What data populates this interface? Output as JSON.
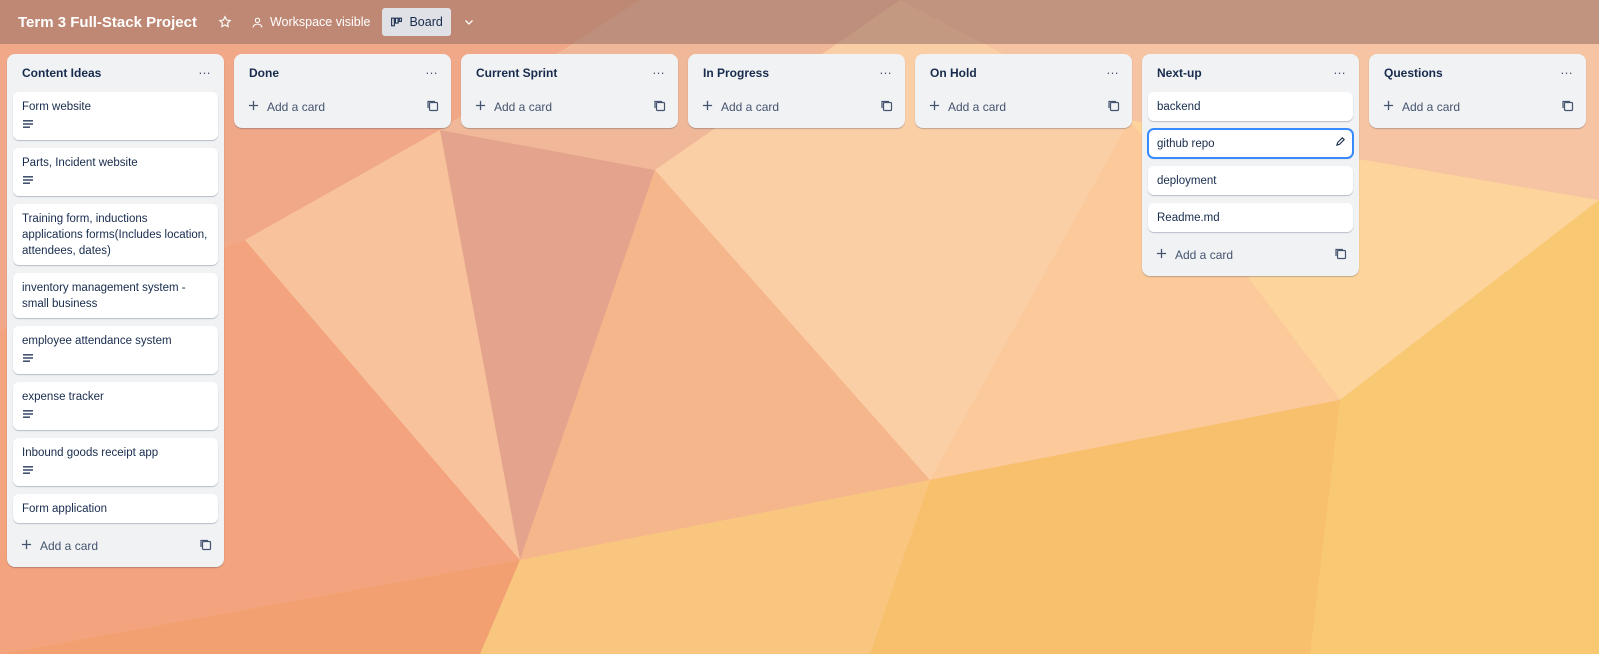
{
  "board": {
    "title": "Term 3 Full-Stack Project",
    "visibility_label": "Workspace visible",
    "view_label": "Board"
  },
  "add_card_label": "Add a card",
  "lists": [
    {
      "title": "Content Ideas",
      "cards": [
        {
          "title": "Form website",
          "has_description": true
        },
        {
          "title": "Parts, Incident website",
          "has_description": true
        },
        {
          "title": "Training form, inductions applications forms(Includes location, attendees, dates)",
          "has_description": false
        },
        {
          "title": "inventory management system - small business",
          "has_description": false
        },
        {
          "title": "employee attendance system",
          "has_description": true
        },
        {
          "title": "expense tracker",
          "has_description": true
        },
        {
          "title": "Inbound goods receipt app",
          "has_description": true
        },
        {
          "title": "Form application",
          "has_description": false
        }
      ]
    },
    {
      "title": "Done",
      "cards": []
    },
    {
      "title": "Current Sprint",
      "cards": []
    },
    {
      "title": "In Progress",
      "cards": []
    },
    {
      "title": "On Hold",
      "cards": []
    },
    {
      "title": "Next-up",
      "cards": [
        {
          "title": "backend",
          "has_description": false
        },
        {
          "title": "github repo",
          "has_description": false,
          "editing": true
        },
        {
          "title": "deployment",
          "has_description": false
        },
        {
          "title": "Readme.md",
          "has_description": false
        }
      ]
    },
    {
      "title": "Questions",
      "cards": []
    }
  ]
}
